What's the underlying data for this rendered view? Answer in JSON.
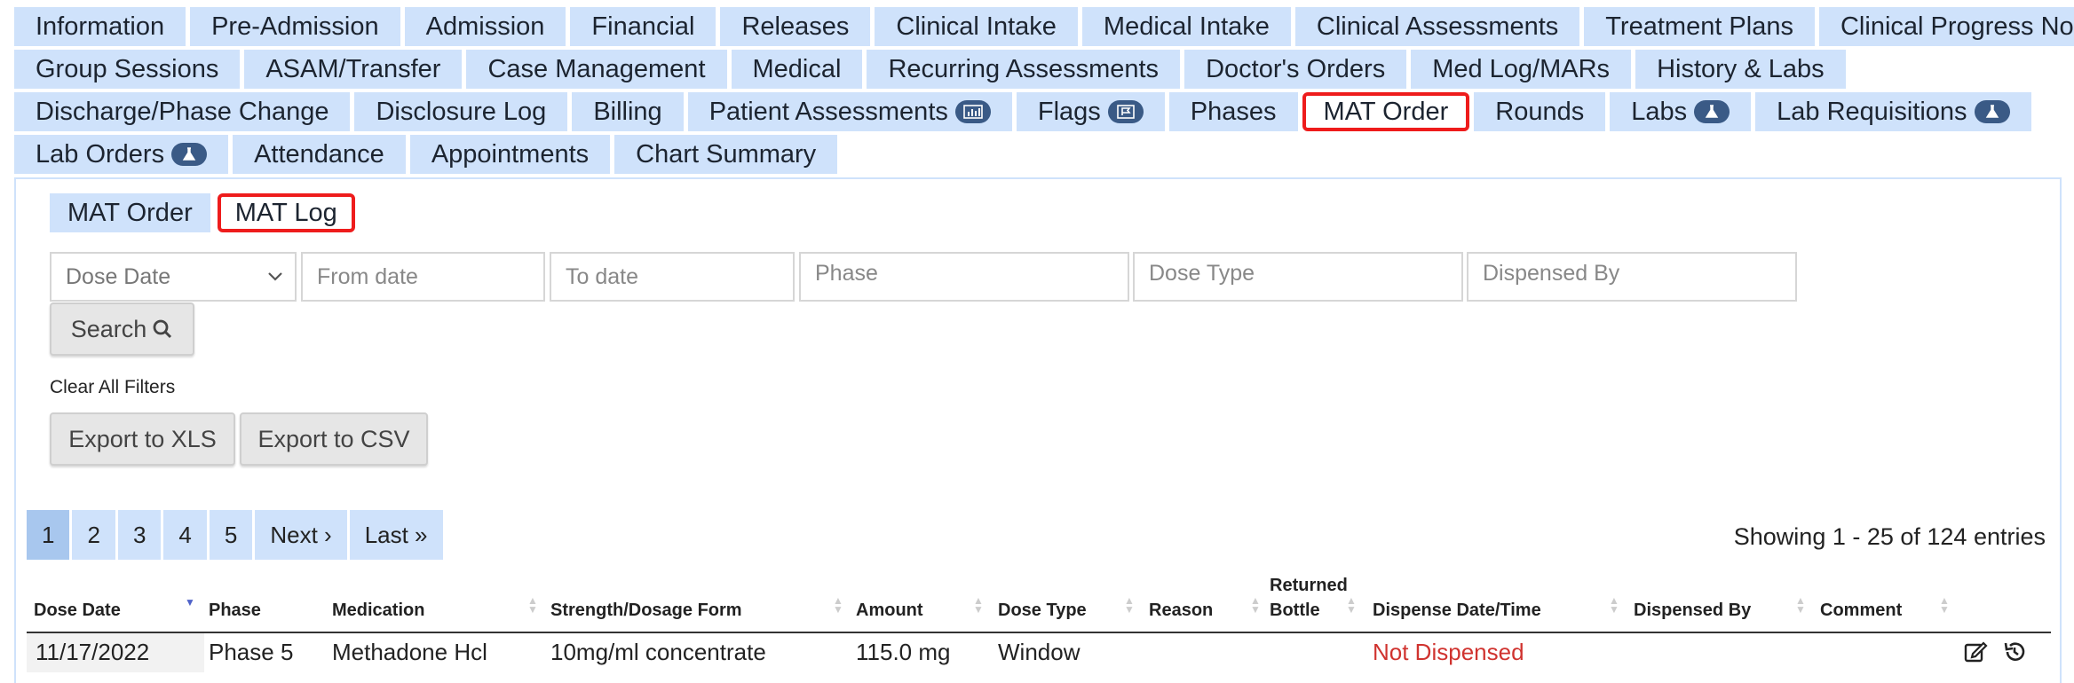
{
  "tabs": {
    "row1": [
      "Information",
      "Pre-Admission",
      "Admission",
      "Financial",
      "Releases",
      "Clinical Intake",
      "Medical Intake",
      "Clinical Assessments",
      "Treatment Plans",
      "Clinical Progress Notes"
    ],
    "row2": [
      "Group Sessions",
      "ASAM/Transfer",
      "Case Management",
      "Medical",
      "Recurring Assessments",
      "Doctor's Orders",
      "Med Log/MARs",
      "History & Labs"
    ],
    "row3": [
      "Discharge/Phase Change",
      "Disclosure Log",
      "Billing",
      "Patient Assessments",
      "Flags",
      "Phases",
      "MAT Order",
      "Rounds",
      "Labs",
      "Lab Requisitions"
    ],
    "row4": [
      "Lab Orders",
      "Attendance",
      "Appointments",
      "Chart Summary"
    ]
  },
  "subtabs": [
    "MAT Order",
    "MAT Log"
  ],
  "filters": {
    "dose_date_select": "Dose Date",
    "from_placeholder": "From date",
    "to_placeholder": "To date",
    "phase_placeholder": "Phase",
    "dose_type_placeholder": "Dose Type",
    "dispensed_by_placeholder": "Dispensed By",
    "search_label": "Search",
    "clear_filters": "Clear All Filters",
    "export_xls": "Export to XLS",
    "export_csv": "Export to CSV"
  },
  "pagination": {
    "pages": [
      "1",
      "2",
      "3",
      "4",
      "5"
    ],
    "next": "Next ›",
    "last": "Last »",
    "current": "1",
    "summary": "Showing 1 - 25 of 124 entries"
  },
  "table": {
    "headers": {
      "dose_date": "Dose Date",
      "phase": "Phase",
      "medication": "Medication",
      "strength": "Strength/Dosage Form",
      "amount": "Amount",
      "dose_type": "Dose Type",
      "reason": "Reason",
      "returned_bottle_1": "Returned",
      "returned_bottle_2": "Bottle",
      "dispense_datetime": "Dispense Date/Time",
      "dispensed_by": "Dispensed By",
      "comment": "Comment"
    },
    "rows": [
      {
        "dose_date": "11/17/2022",
        "phase": "Phase 5",
        "medication": "Methadone Hcl",
        "strength": "10mg/ml concentrate",
        "amount": "115.0 mg",
        "dose_type": "Window",
        "reason": "",
        "returned_bottle": "",
        "dispense_datetime": "Not Dispensed",
        "dispensed_by": "",
        "comment": ""
      }
    ]
  },
  "colors": {
    "tab_bg": "#cfe2fb",
    "highlight": "#ee1c1c",
    "not_dispensed": "#d0332f",
    "pill": "#3a5a86"
  }
}
